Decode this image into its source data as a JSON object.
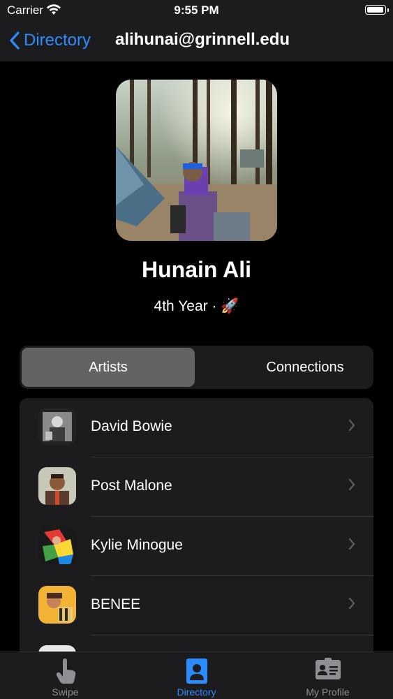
{
  "status": {
    "carrier": "Carrier",
    "time": "9:55 PM",
    "battery_level": 1.0
  },
  "nav": {
    "back_label": "Directory",
    "title": "alihunai@grinnell.edu"
  },
  "profile": {
    "name": "Hunain Ali",
    "year": "4th Year · 🚀"
  },
  "segments": {
    "artists": "Artists",
    "connections": "Connections",
    "selected": "Artists"
  },
  "artists": [
    {
      "name": "David Bowie"
    },
    {
      "name": "Post Malone"
    },
    {
      "name": "Kylie Minogue"
    },
    {
      "name": "BENEE"
    }
  ],
  "tabs": {
    "swipe": "Swipe",
    "directory": "Directory",
    "my_profile": "My Profile",
    "active": "Directory"
  },
  "colors": {
    "accent": "#2a8cff",
    "background": "#000000",
    "surface": "#1c1c1e",
    "segment_active": "#636366"
  }
}
